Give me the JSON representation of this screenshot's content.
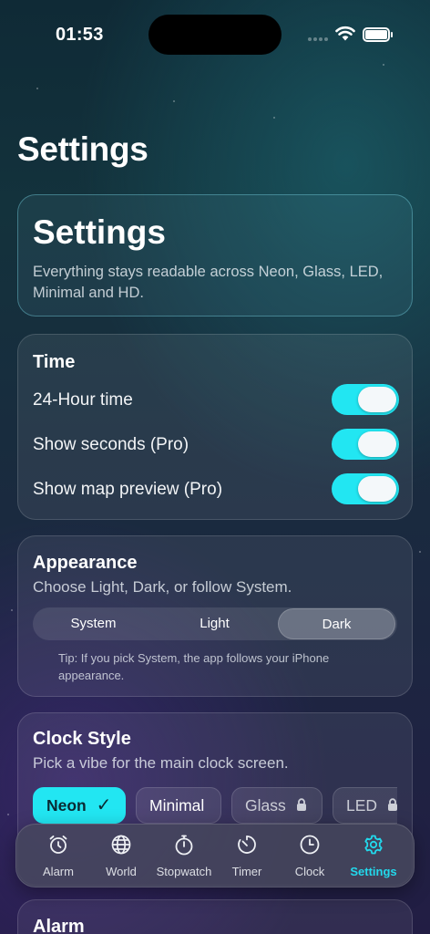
{
  "status_bar": {
    "time": "01:53"
  },
  "page": {
    "title": "Settings"
  },
  "hero": {
    "title": "Settings",
    "subtitle": "Everything stays readable across Neon, Glass, LED, Minimal and HD."
  },
  "time_section": {
    "title": "Time",
    "rows": [
      {
        "label": "24-Hour time",
        "on": true
      },
      {
        "label": "Show seconds (Pro)",
        "on": true
      },
      {
        "label": "Show map preview (Pro)",
        "on": true
      }
    ]
  },
  "appearance": {
    "title": "Appearance",
    "subtitle": "Choose Light, Dark, or follow System.",
    "options": [
      "System",
      "Light",
      "Dark"
    ],
    "selected": "Dark",
    "tip": "Tip: If you pick System, the app follows your iPhone appearance."
  },
  "clock_style": {
    "title": "Clock Style",
    "subtitle": "Pick a vibe for the main clock screen.",
    "options": [
      {
        "label": "Neon",
        "selected": true,
        "locked": false
      },
      {
        "label": "Minimal",
        "selected": false,
        "locked": false
      },
      {
        "label": "Glass",
        "selected": false,
        "locked": true
      },
      {
        "label": "LED",
        "selected": false,
        "locked": true
      }
    ],
    "check_glyph": "✓"
  },
  "alarm_section": {
    "title": "Alarm"
  },
  "tab_bar": {
    "items": [
      {
        "label": "Alarm",
        "icon": "alarm-clock-icon"
      },
      {
        "label": "World",
        "icon": "globe-icon"
      },
      {
        "label": "Stopwatch",
        "icon": "stopwatch-icon"
      },
      {
        "label": "Timer",
        "icon": "timer-icon"
      },
      {
        "label": "Clock",
        "icon": "clock-icon"
      },
      {
        "label": "Settings",
        "icon": "gear-icon"
      }
    ],
    "active": "Settings"
  },
  "colors": {
    "accent": "#22e6f2",
    "tab_active": "#22d9ec",
    "toggle_on": "#22e6f2"
  }
}
